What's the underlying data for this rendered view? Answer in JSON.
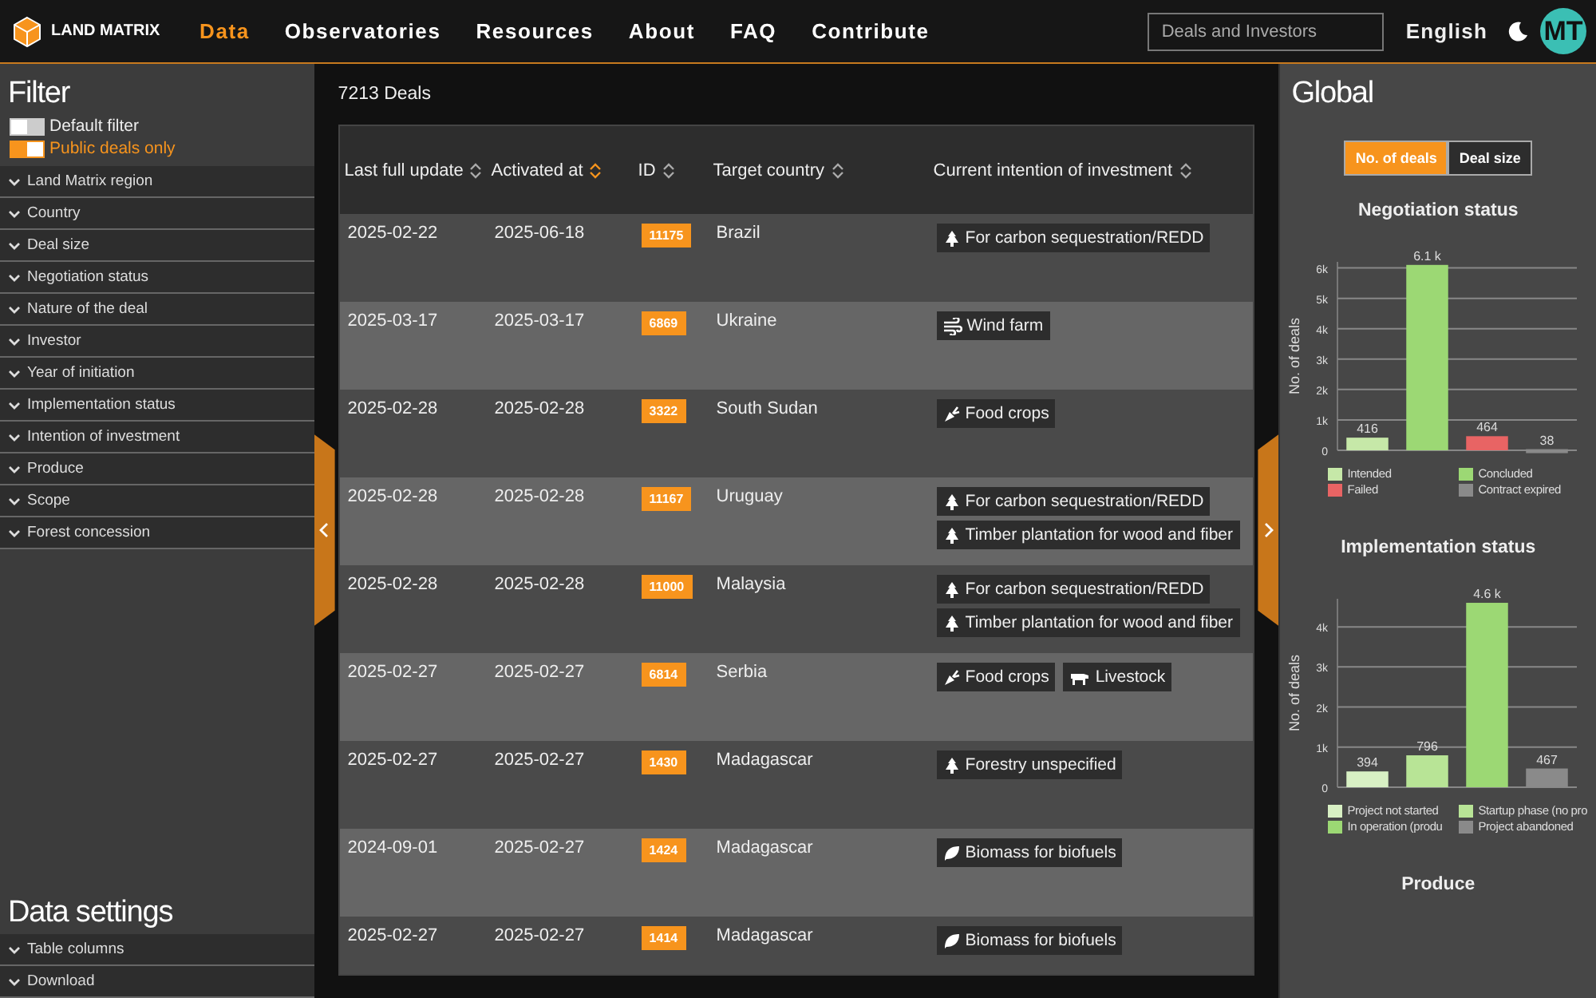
{
  "header": {
    "logo": "LAND MATRIX",
    "nav": [
      {
        "label": "Data",
        "selected": true
      },
      {
        "label": "Observatories",
        "selected": false
      },
      {
        "label": "Resources",
        "selected": false
      },
      {
        "label": "About",
        "selected": false
      },
      {
        "label": "FAQ",
        "selected": false
      },
      {
        "label": "Contribute",
        "selected": false
      }
    ],
    "search": {
      "placeholder": "Deals and Investors"
    },
    "language": "English",
    "avatar": "MT"
  },
  "filter": {
    "title": "Filter",
    "toggles": [
      {
        "label": "Default filter",
        "on": false
      },
      {
        "label": "Public deals only",
        "on": true
      }
    ],
    "sections": [
      "Land Matrix region",
      "Country",
      "Deal size",
      "Negotiation status",
      "Nature of the deal",
      "Investor",
      "Year of initiation",
      "Implementation status",
      "Intention of investment",
      "Produce",
      "Scope",
      "Forest concession"
    ]
  },
  "data_settings": {
    "title": "Data settings",
    "sections": [
      "Table columns",
      "Download"
    ]
  },
  "deals": {
    "count": "7213 Deals",
    "columns": [
      {
        "label": "Last full update",
        "sorted": false
      },
      {
        "label": "Activated at",
        "sorted": true
      },
      {
        "label": "ID",
        "sorted": false
      },
      {
        "label": "Target country",
        "sorted": false
      },
      {
        "label": "Current intention of investment",
        "sorted": false
      }
    ],
    "rows": [
      {
        "updated": "2025-02-22",
        "activated": "2025-06-18",
        "id": "11175",
        "country": "Brazil",
        "intentions": [
          {
            "kind": "tree",
            "label": "For carbon sequestration/REDD"
          }
        ]
      },
      {
        "updated": "2025-03-17",
        "activated": "2025-03-17",
        "id": "6869",
        "country": "Ukraine",
        "intentions": [
          {
            "kind": "wind",
            "label": "Wind farm"
          }
        ]
      },
      {
        "updated": "2025-02-28",
        "activated": "2025-02-28",
        "id": "3322",
        "country": "South Sudan",
        "intentions": [
          {
            "kind": "carrot",
            "label": "Food crops"
          }
        ]
      },
      {
        "updated": "2025-02-28",
        "activated": "2025-02-28",
        "id": "11167",
        "country": "Uruguay",
        "intentions": [
          {
            "kind": "tree",
            "label": "For carbon sequestration/REDD"
          },
          {
            "kind": "tree",
            "label": "Timber plantation for wood and fiber"
          }
        ]
      },
      {
        "updated": "2025-02-28",
        "activated": "2025-02-28",
        "id": "11000",
        "country": "Malaysia",
        "intentions": [
          {
            "kind": "tree",
            "label": "For carbon sequestration/REDD"
          },
          {
            "kind": "tree",
            "label": "Timber plantation for wood and fiber"
          }
        ]
      },
      {
        "updated": "2025-02-27",
        "activated": "2025-02-27",
        "id": "6814",
        "country": "Serbia",
        "intentions": [
          {
            "kind": "carrot",
            "label": "Food crops"
          },
          {
            "kind": "cow",
            "label": "Livestock"
          }
        ]
      },
      {
        "updated": "2025-02-27",
        "activated": "2025-02-27",
        "id": "1430",
        "country": "Madagascar",
        "intentions": [
          {
            "kind": "tree",
            "label": "Forestry unspecified"
          }
        ]
      },
      {
        "updated": "2024-09-01",
        "activated": "2025-02-27",
        "id": "1424",
        "country": "Madagascar",
        "intentions": [
          {
            "kind": "leaf",
            "label": "Biomass for biofuels"
          }
        ]
      },
      {
        "updated": "2025-02-27",
        "activated": "2025-02-27",
        "id": "1414",
        "country": "Madagascar",
        "intentions": [
          {
            "kind": "leaf",
            "label": "Biomass for biofuels"
          }
        ]
      }
    ]
  },
  "global": {
    "title": "Global",
    "modes": [
      {
        "label": "No. of deals",
        "selected": true
      },
      {
        "label": "Deal size",
        "selected": false
      }
    ],
    "charts": [
      {
        "title": "Negotiation status",
        "chart_data": {
          "type": "bar",
          "ylabel": "No. of deals",
          "grid": true,
          "ylim": [
            0,
            6200
          ],
          "series": [
            {
              "name": "Intended",
              "color": "#c6e8a8",
              "values": [
                416
              ]
            },
            {
              "name": "Concluded",
              "color": "#9cd874",
              "values": [
                6100
              ]
            },
            {
              "name": "Failed",
              "color": "#e86464",
              "values": [
                464
              ]
            },
            {
              "name": "Contract expired",
              "color": "#8a8a8a",
              "values": [
                38
              ]
            }
          ],
          "yticks": [
            {
              "value": 0,
              "label": "0"
            },
            {
              "value": 1000,
              "label": "1k"
            },
            {
              "value": 2000,
              "label": "2k"
            },
            {
              "value": 3000,
              "label": "3k"
            },
            {
              "value": 4000,
              "label": "4k"
            },
            {
              "value": 5000,
              "label": "5k"
            },
            {
              "value": 6000,
              "label": "6k"
            }
          ],
          "value_labels": [
            "416",
            "6.1 k",
            "464",
            "38"
          ]
        }
      },
      {
        "title": "Implementation status",
        "chart_data": {
          "type": "bar",
          "ylabel": "No. of deals",
          "grid": true,
          "ylim": [
            0,
            4700
          ],
          "series": [
            {
              "name": "Project not started",
              "color": "#d8f0c4",
              "values": [
                394
              ]
            },
            {
              "name": "Startup phase (no pro",
              "color": "#b8e496",
              "values": [
                796
              ]
            },
            {
              "name": "In operation (produ",
              "color": "#9cd874",
              "values": [
                4600
              ]
            },
            {
              "name": "Project abandoned",
              "color": "#8a8a8a",
              "values": [
                467
              ]
            }
          ],
          "yticks": [
            {
              "value": 0,
              "label": "0"
            },
            {
              "value": 1000,
              "label": "1k"
            },
            {
              "value": 2000,
              "label": "2k"
            },
            {
              "value": 3000,
              "label": "3k"
            },
            {
              "value": 4000,
              "label": "4k"
            }
          ],
          "value_labels": [
            "394",
            "796",
            "4.6 k",
            "467"
          ]
        }
      },
      {
        "title": "Produce"
      }
    ]
  }
}
